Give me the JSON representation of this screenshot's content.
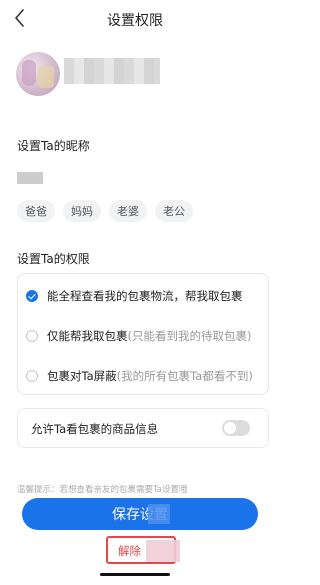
{
  "header": {
    "title": "设置权限"
  },
  "nickname": {
    "label": "设置Ta的昵称",
    "chips": [
      "爸爸",
      "妈妈",
      "老婆",
      "老公"
    ]
  },
  "permissions": {
    "label": "设置Ta的权限",
    "options": [
      {
        "main": "能全程查看我的包裹物流，帮我取包裹",
        "sub": "",
        "selected": true
      },
      {
        "main": "仅能帮我取包裹",
        "sub": " (只能看到我的待取包裹)",
        "selected": false
      },
      {
        "main": "包裹对Ta屏蔽",
        "sub": " (我的所有包裹Ta都看不到)",
        "selected": false
      }
    ]
  },
  "goods_info": {
    "label": "允许Ta看包裹的商品信息",
    "enabled": false
  },
  "tip": "温馨提示：若想查看亲友的包裹需要Ta设置哦",
  "save_button": "保存设置",
  "unbind_button": "解除",
  "colors": {
    "accent": "#1a73e8",
    "danger": "#e34848"
  }
}
